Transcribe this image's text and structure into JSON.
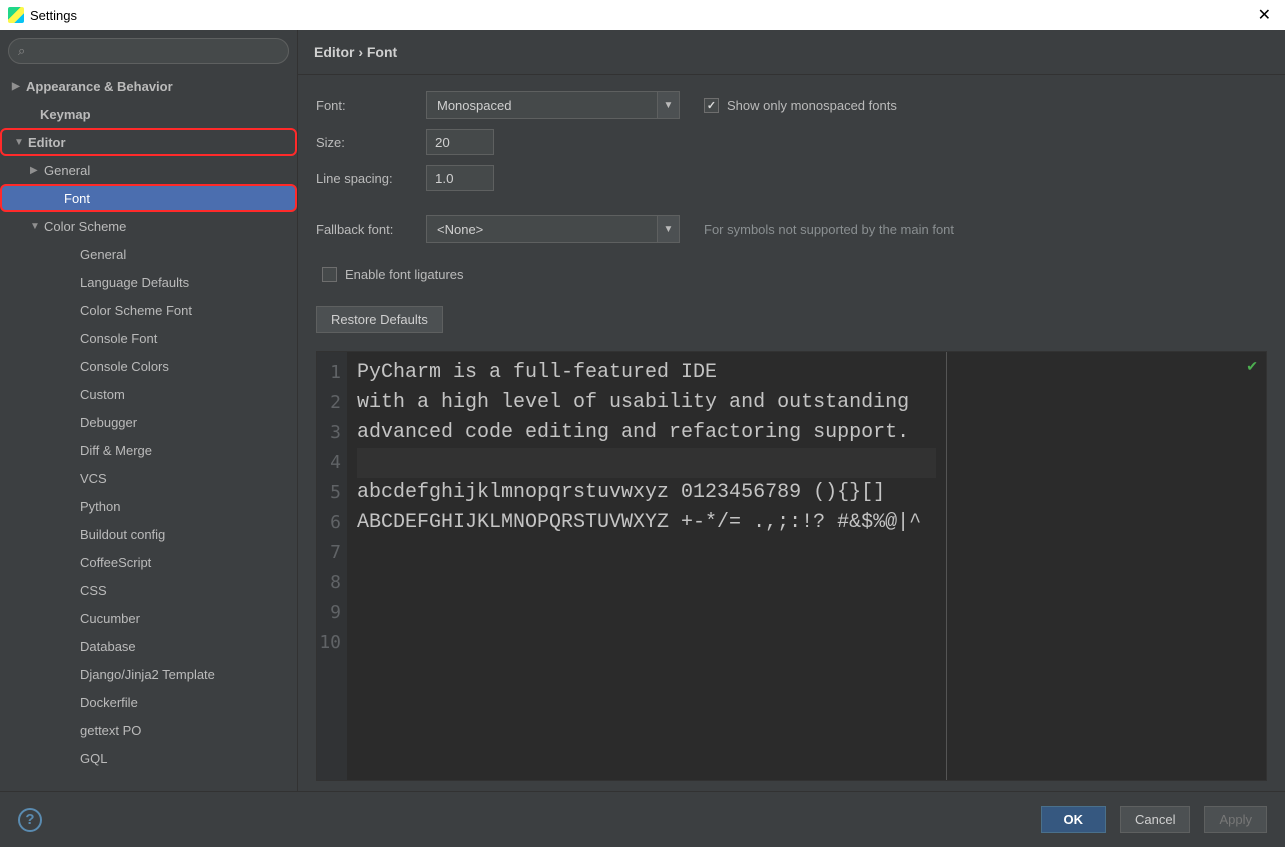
{
  "window": {
    "title": "Settings"
  },
  "sidebar": {
    "search_placeholder": "",
    "items": [
      {
        "label": "Appearance & Behavior",
        "caret": "▶",
        "bold": true,
        "indent": 0
      },
      {
        "label": "Keymap",
        "caret": "",
        "bold": true,
        "indent": 0,
        "pad": true
      },
      {
        "label": "Editor",
        "caret": "▼",
        "bold": true,
        "indent": 0,
        "highlight": true
      },
      {
        "label": "General",
        "caret": "▶",
        "bold": false,
        "indent": 1
      },
      {
        "label": "Font",
        "caret": "",
        "bold": false,
        "indent": 2,
        "selected": true,
        "highlight": true
      },
      {
        "label": "Color Scheme",
        "caret": "▼",
        "bold": false,
        "indent": 1
      },
      {
        "label": "General",
        "caret": "",
        "bold": false,
        "indent": 3
      },
      {
        "label": "Language Defaults",
        "caret": "",
        "bold": false,
        "indent": 3
      },
      {
        "label": "Color Scheme Font",
        "caret": "",
        "bold": false,
        "indent": 3
      },
      {
        "label": "Console Font",
        "caret": "",
        "bold": false,
        "indent": 3
      },
      {
        "label": "Console Colors",
        "caret": "",
        "bold": false,
        "indent": 3
      },
      {
        "label": "Custom",
        "caret": "",
        "bold": false,
        "indent": 3
      },
      {
        "label": "Debugger",
        "caret": "",
        "bold": false,
        "indent": 3
      },
      {
        "label": "Diff & Merge",
        "caret": "",
        "bold": false,
        "indent": 3
      },
      {
        "label": "VCS",
        "caret": "",
        "bold": false,
        "indent": 3
      },
      {
        "label": "Python",
        "caret": "",
        "bold": false,
        "indent": 3
      },
      {
        "label": "Buildout config",
        "caret": "",
        "bold": false,
        "indent": 3
      },
      {
        "label": "CoffeeScript",
        "caret": "",
        "bold": false,
        "indent": 3
      },
      {
        "label": "CSS",
        "caret": "",
        "bold": false,
        "indent": 3
      },
      {
        "label": "Cucumber",
        "caret": "",
        "bold": false,
        "indent": 3
      },
      {
        "label": "Database",
        "caret": "",
        "bold": false,
        "indent": 3
      },
      {
        "label": "Django/Jinja2 Template",
        "caret": "",
        "bold": false,
        "indent": 3
      },
      {
        "label": "Dockerfile",
        "caret": "",
        "bold": false,
        "indent": 3
      },
      {
        "label": "gettext PO",
        "caret": "",
        "bold": false,
        "indent": 3
      },
      {
        "label": "GQL",
        "caret": "",
        "bold": false,
        "indent": 3
      }
    ]
  },
  "breadcrumb": "Editor › Font",
  "form": {
    "font_label": "Font:",
    "font_value": "Monospaced",
    "mono_only_label": "Show only monospaced fonts",
    "size_label": "Size:",
    "size_value": "20",
    "spacing_label": "Line spacing:",
    "spacing_value": "1.0",
    "fallback_label": "Fallback font:",
    "fallback_value": "<None>",
    "fallback_hint": "For symbols not supported by the main font",
    "ligatures_label": "Enable font ligatures",
    "restore_label": "Restore Defaults"
  },
  "preview": {
    "lines": [
      "PyCharm is a full-featured IDE",
      "with a high level of usability and outstanding",
      "advanced code editing and refactoring support.",
      "",
      "abcdefghijklmnopqrstuvwxyz 0123456789 (){}[]",
      "ABCDEFGHIJKLMNOPQRSTUVWXYZ +-*/= .,;:!? #&$%@|^",
      "",
      "",
      "",
      ""
    ]
  },
  "footer": {
    "ok": "OK",
    "cancel": "Cancel",
    "apply": "Apply"
  }
}
